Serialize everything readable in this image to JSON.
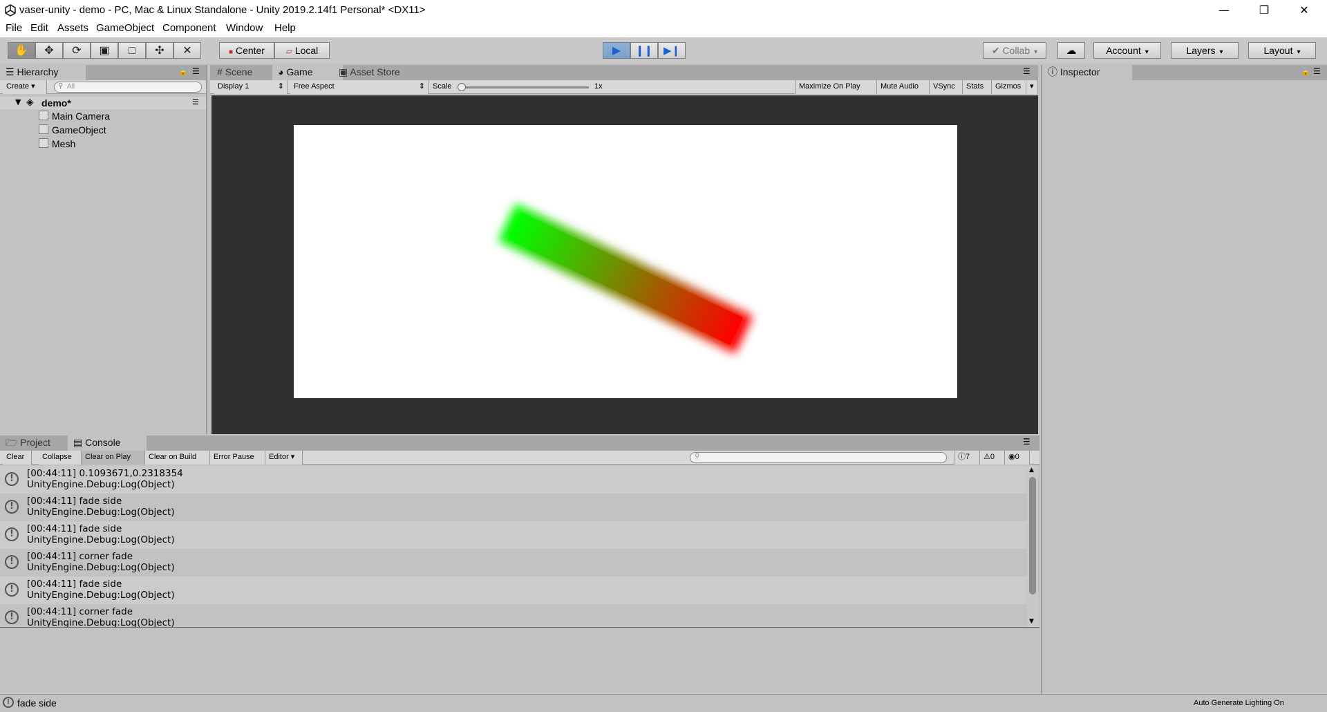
{
  "window": {
    "title": "vaser-unity - demo - PC, Mac & Linux Standalone - Unity 2019.2.14f1 Personal* <DX11>",
    "minimize": "—",
    "maximize": "❐",
    "close": "✕"
  },
  "menu": [
    "File",
    "Edit",
    "Assets",
    "GameObject",
    "Component",
    "Window",
    "Help"
  ],
  "toolbar": {
    "tools": [
      "hand-tool-icon",
      "move-tool-icon",
      "rotate-tool-icon",
      "scale-tool-icon",
      "rect-tool-icon",
      "transform-tool-icon",
      "custom-tool-icon"
    ],
    "pivot": "Center",
    "space": "Local",
    "collab": "Collab",
    "account": "Account",
    "layers": "Layers",
    "layout": "Layout"
  },
  "hierarchy": {
    "tab": "Hierarchy",
    "create": "Create",
    "search_placeholder": "All",
    "scene": "demo*",
    "items": [
      "Main Camera",
      "GameObject",
      "Mesh"
    ]
  },
  "viewTabs": {
    "scene": "Scene",
    "game": "Game",
    "store": "Asset Store"
  },
  "gameBar": {
    "display": "Display 1",
    "aspect": "Free Aspect",
    "scale_label": "Scale",
    "scale_value": "1x",
    "maximize": "Maximize On Play",
    "mute": "Mute Audio",
    "vsync": "VSync",
    "stats": "Stats",
    "gizmos": "Gizmos"
  },
  "gameView": {
    "colors": {
      "start": "#00ff00",
      "end": "#ff0000"
    }
  },
  "inspector": {
    "tab": "Inspector"
  },
  "bottomTabs": {
    "project": "Project",
    "console": "Console"
  },
  "consoleBar": {
    "clear": "Clear",
    "collapse": "Collapse",
    "clear_on_play": "Clear on Play",
    "clear_on_build": "Clear on Build",
    "error_pause": "Error Pause",
    "editor": "Editor",
    "count_info": "7",
    "count_warn": "0",
    "count_error": "0"
  },
  "console": {
    "entries": [
      {
        "line1": "[00:44:11] 0.1093671,0.2318354",
        "line2": "UnityEngine.Debug:Log(Object)"
      },
      {
        "line1": "[00:44:11] fade side",
        "line2": "UnityEngine.Debug:Log(Object)"
      },
      {
        "line1": "[00:44:11] fade side",
        "line2": "UnityEngine.Debug:Log(Object)"
      },
      {
        "line1": "[00:44:11] corner fade",
        "line2": "UnityEngine.Debug:Log(Object)"
      },
      {
        "line1": "[00:44:11] fade side",
        "line2": "UnityEngine.Debug:Log(Object)"
      },
      {
        "line1": "[00:44:11] corner fade",
        "line2": "UnityEngine.Debug:Log(Object)"
      }
    ]
  },
  "statusbar": {
    "message": "fade side",
    "lighting": "Auto Generate Lighting On"
  }
}
